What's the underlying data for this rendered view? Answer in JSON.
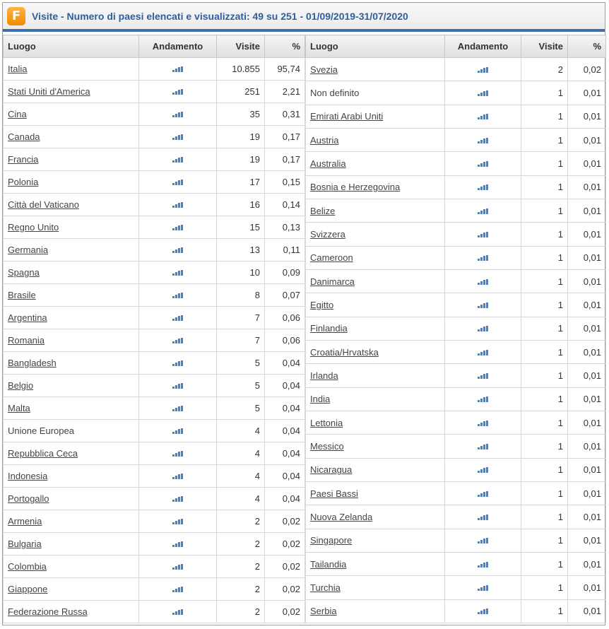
{
  "header": {
    "logo_letter": "F",
    "title": "Visite - Numero di paesi elencati e visualizzati: 49 su 251 - 01/09/2019-31/07/2020"
  },
  "columns": {
    "place": "Luogo",
    "trend": "Andamento",
    "visits": "Visite",
    "percent": "%"
  },
  "colors": {
    "accent": "#3f6ea5",
    "title": "#2e5f9c",
    "logo": "#f08a00",
    "trend_icon": "#5b7ca6"
  },
  "trend_icon": "bar-trend-icon",
  "left_rows": [
    {
      "name": "Italia",
      "visits": "10.855",
      "percent": "95,74",
      "link": true
    },
    {
      "name": "Stati Uniti d'America",
      "visits": "251",
      "percent": "2,21",
      "link": true
    },
    {
      "name": "Cina",
      "visits": "35",
      "percent": "0,31",
      "link": true
    },
    {
      "name": "Canada",
      "visits": "19",
      "percent": "0,17",
      "link": true
    },
    {
      "name": "Francia",
      "visits": "19",
      "percent": "0,17",
      "link": true
    },
    {
      "name": "Polonia",
      "visits": "17",
      "percent": "0,15",
      "link": true
    },
    {
      "name": "Città del Vaticano",
      "visits": "16",
      "percent": "0,14",
      "link": true
    },
    {
      "name": "Regno Unito",
      "visits": "15",
      "percent": "0,13",
      "link": true
    },
    {
      "name": "Germania",
      "visits": "13",
      "percent": "0,11",
      "link": true
    },
    {
      "name": "Spagna",
      "visits": "10",
      "percent": "0,09",
      "link": true
    },
    {
      "name": "Brasile",
      "visits": "8",
      "percent": "0,07",
      "link": true
    },
    {
      "name": "Argentina",
      "visits": "7",
      "percent": "0,06",
      "link": true
    },
    {
      "name": "Romania",
      "visits": "7",
      "percent": "0,06",
      "link": true
    },
    {
      "name": "Bangladesh",
      "visits": "5",
      "percent": "0,04",
      "link": true
    },
    {
      "name": "Belgio",
      "visits": "5",
      "percent": "0,04",
      "link": true
    },
    {
      "name": "Malta",
      "visits": "5",
      "percent": "0,04",
      "link": true
    },
    {
      "name": "Unione Europea",
      "visits": "4",
      "percent": "0,04",
      "link": false
    },
    {
      "name": "Repubblica Ceca",
      "visits": "4",
      "percent": "0,04",
      "link": true
    },
    {
      "name": "Indonesia",
      "visits": "4",
      "percent": "0,04",
      "link": true
    },
    {
      "name": "Portogallo",
      "visits": "4",
      "percent": "0,04",
      "link": true
    },
    {
      "name": "Armenia",
      "visits": "2",
      "percent": "0,02",
      "link": true
    },
    {
      "name": "Bulgaria",
      "visits": "2",
      "percent": "0,02",
      "link": true
    },
    {
      "name": "Colombia",
      "visits": "2",
      "percent": "0,02",
      "link": true
    },
    {
      "name": "Giappone",
      "visits": "2",
      "percent": "0,02",
      "link": true
    },
    {
      "name": "Federazione Russa",
      "visits": "2",
      "percent": "0,02",
      "link": true
    }
  ],
  "right_rows": [
    {
      "name": "Svezia",
      "visits": "2",
      "percent": "0,02",
      "link": true
    },
    {
      "name": "Non definito",
      "visits": "1",
      "percent": "0,01",
      "link": false
    },
    {
      "name": "Emirati Arabi Uniti",
      "visits": "1",
      "percent": "0,01",
      "link": true
    },
    {
      "name": "Austria",
      "visits": "1",
      "percent": "0,01",
      "link": true
    },
    {
      "name": "Australia",
      "visits": "1",
      "percent": "0,01",
      "link": true
    },
    {
      "name": "Bosnia e Herzegovina",
      "visits": "1",
      "percent": "0,01",
      "link": true
    },
    {
      "name": "Belize",
      "visits": "1",
      "percent": "0,01",
      "link": true
    },
    {
      "name": "Svizzera",
      "visits": "1",
      "percent": "0,01",
      "link": true
    },
    {
      "name": "Cameroon",
      "visits": "1",
      "percent": "0,01",
      "link": true
    },
    {
      "name": "Danimarca",
      "visits": "1",
      "percent": "0,01",
      "link": true
    },
    {
      "name": "Egitto",
      "visits": "1",
      "percent": "0,01",
      "link": true
    },
    {
      "name": "Finlandia",
      "visits": "1",
      "percent": "0,01",
      "link": true
    },
    {
      "name": "Croatia/Hrvatska",
      "visits": "1",
      "percent": "0,01",
      "link": true
    },
    {
      "name": "Irlanda",
      "visits": "1",
      "percent": "0,01",
      "link": true
    },
    {
      "name": "India",
      "visits": "1",
      "percent": "0,01",
      "link": true
    },
    {
      "name": "Lettonia",
      "visits": "1",
      "percent": "0,01",
      "link": true
    },
    {
      "name": "Messico",
      "visits": "1",
      "percent": "0,01",
      "link": true
    },
    {
      "name": "Nicaragua",
      "visits": "1",
      "percent": "0,01",
      "link": true
    },
    {
      "name": "Paesi Bassi",
      "visits": "1",
      "percent": "0,01",
      "link": true
    },
    {
      "name": "Nuova Zelanda",
      "visits": "1",
      "percent": "0,01",
      "link": true
    },
    {
      "name": "Singapore",
      "visits": "1",
      "percent": "0,01",
      "link": true
    },
    {
      "name": "Tailandia",
      "visits": "1",
      "percent": "0,01",
      "link": true
    },
    {
      "name": "Turchia",
      "visits": "1",
      "percent": "0,01",
      "link": true
    },
    {
      "name": "Serbia",
      "visits": "1",
      "percent": "0,01",
      "link": true
    }
  ]
}
